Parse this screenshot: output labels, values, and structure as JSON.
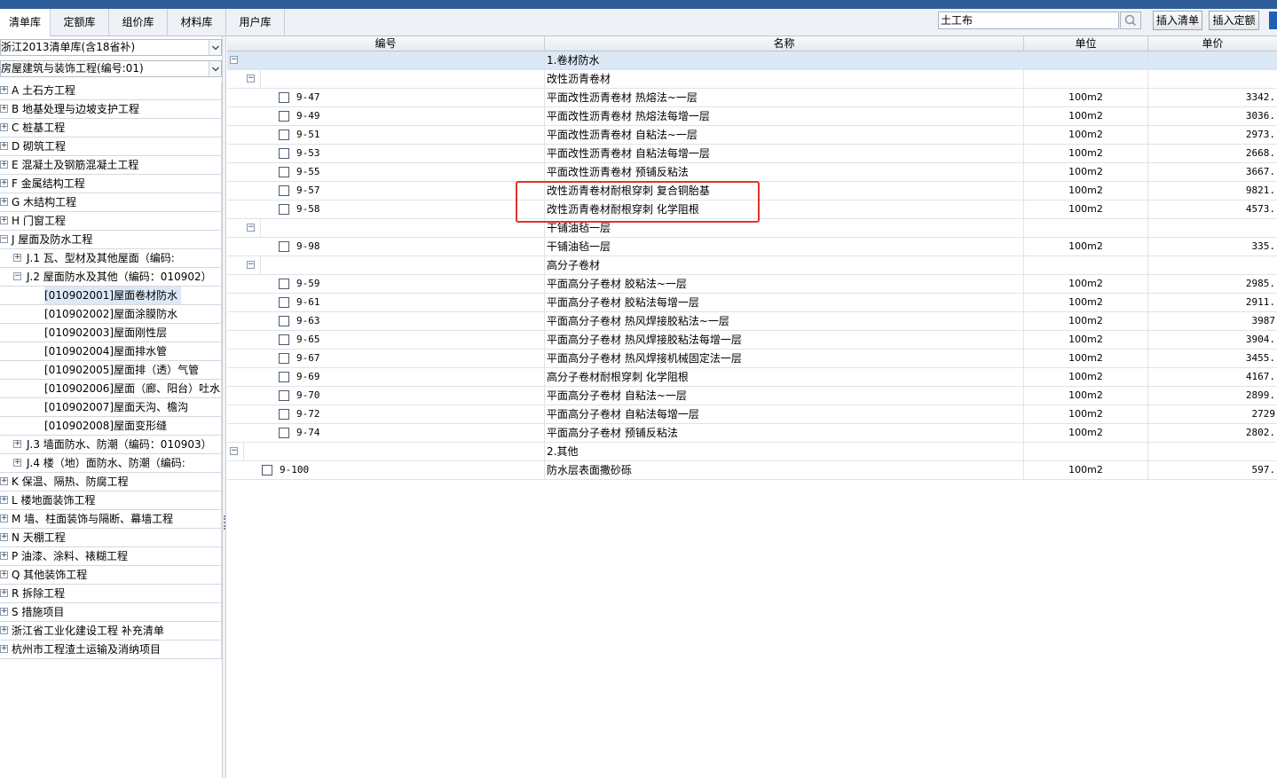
{
  "tabs": [
    {
      "label": "清单库",
      "active": true
    },
    {
      "label": "定额库",
      "active": false
    },
    {
      "label": "组价库",
      "active": false
    },
    {
      "label": "材料库",
      "active": false
    },
    {
      "label": "用户库",
      "active": false
    }
  ],
  "search": {
    "value": "土工布"
  },
  "toolbar": {
    "insert_list": "插入清单",
    "insert_quota": "插入定额"
  },
  "left": {
    "library_select": "浙江2013清单库(含18省补)",
    "project_select": "房屋建筑与装饰工程(编号:01)",
    "tree": [
      {
        "label": "A 土石方工程",
        "level": 0,
        "exp": "+"
      },
      {
        "label": "B 地基处理与边坡支护工程",
        "level": 0,
        "exp": "+"
      },
      {
        "label": "C 桩基工程",
        "level": 0,
        "exp": "+"
      },
      {
        "label": "D 砌筑工程",
        "level": 0,
        "exp": "+"
      },
      {
        "label": "E 混凝土及钢筋混凝土工程",
        "level": 0,
        "exp": "+"
      },
      {
        "label": "F 金属结构工程",
        "level": 0,
        "exp": "+"
      },
      {
        "label": "G 木结构工程",
        "level": 0,
        "exp": "+"
      },
      {
        "label": "H 门窗工程",
        "level": 0,
        "exp": "+"
      },
      {
        "label": "J 屋面及防水工程",
        "level": 0,
        "exp": "-"
      },
      {
        "label": "J.1 瓦、型材及其他屋面（编码:",
        "level": 1,
        "exp": "+"
      },
      {
        "label": "J.2 屋面防水及其他（编码：010902）",
        "level": 1,
        "exp": "-"
      },
      {
        "label": "[010902001]屋面卷材防水",
        "level": 2,
        "exp": "",
        "selected": true
      },
      {
        "label": "[010902002]屋面涂膜防水",
        "level": 2,
        "exp": ""
      },
      {
        "label": "[010902003]屋面刚性层",
        "level": 2,
        "exp": ""
      },
      {
        "label": "[010902004]屋面排水管",
        "level": 2,
        "exp": ""
      },
      {
        "label": "[010902005]屋面排（透）气管",
        "level": 2,
        "exp": ""
      },
      {
        "label": "[010902006]屋面（廊、阳台）吐水",
        "level": 2,
        "exp": ""
      },
      {
        "label": "[010902007]屋面天沟、檐沟",
        "level": 2,
        "exp": ""
      },
      {
        "label": "[010902008]屋面变形缝",
        "level": 2,
        "exp": ""
      },
      {
        "label": "J.3 墙面防水、防潮（编码：010903）",
        "level": 1,
        "exp": "+"
      },
      {
        "label": "J.4 楼（地）面防水、防潮（编码:",
        "level": 1,
        "exp": "+"
      },
      {
        "label": "K 保温、隔热、防腐工程",
        "level": 0,
        "exp": "+"
      },
      {
        "label": "L 楼地面装饰工程",
        "level": 0,
        "exp": "+"
      },
      {
        "label": "M 墙、柱面装饰与隔断、幕墙工程",
        "level": 0,
        "exp": "+"
      },
      {
        "label": "N 天棚工程",
        "level": 0,
        "exp": "+"
      },
      {
        "label": "P 油漆、涂料、裱糊工程",
        "level": 0,
        "exp": "+"
      },
      {
        "label": "Q 其他装饰工程",
        "level": 0,
        "exp": "+"
      },
      {
        "label": "R 拆除工程",
        "level": 0,
        "exp": "+"
      },
      {
        "label": "S 措施项目",
        "level": 0,
        "exp": "+"
      },
      {
        "label": "浙江省工业化建设工程 补充清单",
        "level": 0,
        "exp": "+"
      },
      {
        "label": "杭州市工程渣土运输及消纳项目",
        "level": 0,
        "exp": "+"
      }
    ]
  },
  "grid": {
    "headers": {
      "code": "编号",
      "name": "名称",
      "unit": "单位",
      "price": "单价"
    },
    "rows": [
      {
        "type": "group",
        "level": 0,
        "code": "",
        "name": "1.卷材防水",
        "unit": "",
        "price": "",
        "highlight": true
      },
      {
        "type": "group",
        "level": 1,
        "code": "",
        "name": "改性沥青卷材",
        "unit": "",
        "price": ""
      },
      {
        "type": "item",
        "level": 2,
        "code": "9-47",
        "name": "平面改性沥青卷材 热熔法~一层",
        "unit": "100m2",
        "price": "3342."
      },
      {
        "type": "item",
        "level": 2,
        "code": "9-49",
        "name": "平面改性沥青卷材 热熔法每增一层",
        "unit": "100m2",
        "price": "3036."
      },
      {
        "type": "item",
        "level": 2,
        "code": "9-51",
        "name": "平面改性沥青卷材 自粘法~一层",
        "unit": "100m2",
        "price": "2973."
      },
      {
        "type": "item",
        "level": 2,
        "code": "9-53",
        "name": "平面改性沥青卷材 自粘法每增一层",
        "unit": "100m2",
        "price": "2668."
      },
      {
        "type": "item",
        "level": 2,
        "code": "9-55",
        "name": "平面改性沥青卷材 预铺反粘法",
        "unit": "100m2",
        "price": "3667."
      },
      {
        "type": "item",
        "level": 2,
        "code": "9-57",
        "name": "改性沥青卷材耐根穿刺 复合铜胎基",
        "unit": "100m2",
        "price": "9821."
      },
      {
        "type": "item",
        "level": 2,
        "code": "9-58",
        "name": "改性沥青卷材耐根穿刺 化学阻根",
        "unit": "100m2",
        "price": "4573."
      },
      {
        "type": "group",
        "level": 1,
        "code": "",
        "name": "干铺油毡一层",
        "unit": "",
        "price": ""
      },
      {
        "type": "item",
        "level": 2,
        "code": "9-98",
        "name": "干铺油毡一层",
        "unit": "100m2",
        "price": "335."
      },
      {
        "type": "group",
        "level": 1,
        "code": "",
        "name": "高分子卷材",
        "unit": "",
        "price": ""
      },
      {
        "type": "item",
        "level": 2,
        "code": "9-59",
        "name": "平面高分子卷材 胶粘法~一层",
        "unit": "100m2",
        "price": "2985."
      },
      {
        "type": "item",
        "level": 2,
        "code": "9-61",
        "name": "平面高分子卷材 胶粘法每增一层",
        "unit": "100m2",
        "price": "2911."
      },
      {
        "type": "item",
        "level": 2,
        "code": "9-63",
        "name": "平面高分子卷材 热风焊接胶粘法~一层",
        "unit": "100m2",
        "price": "3987"
      },
      {
        "type": "item",
        "level": 2,
        "code": "9-65",
        "name": "平面高分子卷材 热风焊接胶粘法每增一层",
        "unit": "100m2",
        "price": "3904."
      },
      {
        "type": "item",
        "level": 2,
        "code": "9-67",
        "name": "平面高分子卷材 热风焊接机械固定法一层",
        "unit": "100m2",
        "price": "3455."
      },
      {
        "type": "item",
        "level": 2,
        "code": "9-69",
        "name": "高分子卷材耐根穿刺 化学阻根",
        "unit": "100m2",
        "price": "4167."
      },
      {
        "type": "item",
        "level": 2,
        "code": "9-70",
        "name": "平面高分子卷材 自粘法~一层",
        "unit": "100m2",
        "price": "2899."
      },
      {
        "type": "item",
        "level": 2,
        "code": "9-72",
        "name": "平面高分子卷材 自粘法每增一层",
        "unit": "100m2",
        "price": "2729"
      },
      {
        "type": "item",
        "level": 2,
        "code": "9-74",
        "name": "平面高分子卷材 预铺反粘法",
        "unit": "100m2",
        "price": "2802."
      },
      {
        "type": "group",
        "level": 0,
        "code": "",
        "name": "2.其他",
        "unit": "",
        "price": ""
      },
      {
        "type": "item",
        "level": 1,
        "code": "9-100",
        "name": "防水层表面撒砂砾",
        "unit": "100m2",
        "price": "597."
      }
    ]
  }
}
